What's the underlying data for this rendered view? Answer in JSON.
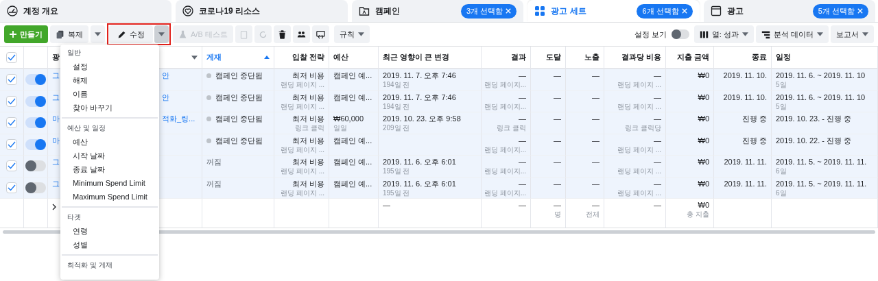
{
  "tabs": [
    {
      "label": "계정 개요",
      "kind": "gauge",
      "selected": false
    },
    {
      "label": "코로나19 리소스",
      "kind": "heart",
      "selected": false
    },
    {
      "label": "캠페인",
      "kind": "folder",
      "selected": false,
      "badge": "3개 선택함"
    },
    {
      "label": "광고 세트",
      "kind": "grid",
      "selected": true,
      "badge": "6개 선택함"
    },
    {
      "label": "광고",
      "kind": "window",
      "selected": false,
      "badge": "5개 선택함"
    }
  ],
  "toolbar": {
    "create": "만들기",
    "duplicate": "복제",
    "edit": "수정",
    "edit_highlighted": true,
    "ab_test": "A/B 테스트",
    "rules": "규칙",
    "view_setup": {
      "label": "설정 보기",
      "on": false
    },
    "columns": "열: 성과",
    "breakdown": "분석 데이터",
    "reports": "보고서"
  },
  "edit_menu": [
    {
      "title": "일반",
      "items": [
        "설정",
        "해제",
        "이름",
        "찾아 바꾸기"
      ]
    },
    {
      "title": "예산 및 일정",
      "items": [
        "예산",
        "시작 날짜",
        "종료 날짜",
        "Minimum Spend Limit",
        "Maximum Spend Limit"
      ]
    },
    {
      "title": "타겟",
      "items": [
        "연령",
        "성별"
      ]
    },
    {
      "title": "최적화 및 게재"
    }
  ],
  "table": {
    "all_checked": true,
    "columns": [
      {
        "label": "광",
        "sorted": false
      },
      {
        "label": "게재",
        "sorted": true
      },
      {
        "label": "입찰 전략",
        "sorted": false
      },
      {
        "label": "예산",
        "sorted": false
      },
      {
        "label": "최근 영향이 큰 변경",
        "sorted": false
      },
      {
        "label": "결과",
        "sorted": false
      },
      {
        "label": "도달",
        "sorted": false
      },
      {
        "label": "노출",
        "sorted": false
      },
      {
        "label": "결과당 비용",
        "sorted": false
      },
      {
        "label": "지출 금액",
        "sorted": false
      },
      {
        "label": "종료",
        "sorted": false
      },
      {
        "label": "일정",
        "sorted": false
      }
    ],
    "rows": [
      {
        "selected": true,
        "on": true,
        "cells": [
          {
            "text": "그",
            "text_end": "안"
          },
          {
            "kind": "paused",
            "text": "캠페인 중단됨"
          },
          {
            "text": "최저 비용",
            "sub": "랜딩 페이지 ..."
          },
          {
            "text": "캠페인 예..."
          },
          {
            "text": "2019. 11. 7. 오후 7:46",
            "sub": "194일 전"
          },
          {
            "text": "—",
            "sub": "랜딩 페이지..."
          },
          {
            "text": "—"
          },
          {
            "text": "—"
          },
          {
            "text": "—",
            "sub": "랜딩 페이지 ..."
          },
          {
            "text": "₩0"
          },
          {
            "text": "2019. 11. 10."
          },
          {
            "text": "2019. 11. 6. ~ 2019. 11. 10",
            "sub": "5일"
          }
        ]
      },
      {
        "selected": true,
        "on": true,
        "cells": [
          {
            "text": "그",
            "text_end": "안"
          },
          {
            "kind": "paused",
            "text": "캠페인 중단됨"
          },
          {
            "text": "최저 비용",
            "sub": "랜딩 페이지 ..."
          },
          {
            "text": "캠페인 예..."
          },
          {
            "text": "2019. 11. 7. 오후 7:46",
            "sub": "194일 전"
          },
          {
            "text": "—",
            "sub": "랜딩 페이지..."
          },
          {
            "text": "—"
          },
          {
            "text": "—"
          },
          {
            "text": "—",
            "sub": "랜딩 페이지 ..."
          },
          {
            "text": "₩0"
          },
          {
            "text": "2019. 11. 10."
          },
          {
            "text": "2019. 11. 6. ~ 2019. 11. 10",
            "sub": "5일"
          }
        ]
      },
      {
        "selected": true,
        "on": true,
        "cells": [
          {
            "text": "마",
            "text_end": "적화_링..."
          },
          {
            "kind": "paused",
            "text": "캠페인 중단됨"
          },
          {
            "text": "최저 비용",
            "sub": "링크 클릭"
          },
          {
            "text": "₩60,000",
            "sub": "일일"
          },
          {
            "text": "2019. 10. 23. 오후 9:58",
            "sub": "209일 전"
          },
          {
            "text": "—",
            "sub": "링크 클릭"
          },
          {
            "text": "—"
          },
          {
            "text": "—"
          },
          {
            "text": "—",
            "sub": "링크 클릭당"
          },
          {
            "text": "₩0"
          },
          {
            "text": "진행 중"
          },
          {
            "text": "2019. 10. 23. - 진행 중"
          }
        ]
      },
      {
        "selected": true,
        "on": true,
        "cells": [
          {
            "text": "마"
          },
          {
            "kind": "paused",
            "text": "캠페인 중단됨"
          },
          {
            "text": "최저 비용",
            "sub": "랜딩 페이지 ..."
          },
          {
            "text": "캠페인 예..."
          },
          null,
          {
            "text": "—",
            "sub": "랜딩 페이지..."
          },
          {
            "text": "—"
          },
          {
            "text": "—"
          },
          {
            "text": "—",
            "sub": "랜딩 페이지 ..."
          },
          {
            "text": "₩0"
          },
          {
            "text": "진행 중"
          },
          {
            "text": "2019. 10. 22. - 진행 중"
          }
        ]
      },
      {
        "selected": true,
        "on": false,
        "cells": [
          {
            "text": "그"
          },
          {
            "kind": "off",
            "text": "꺼짐"
          },
          {
            "text": "최저 비용",
            "sub": "랜딩 페이지 ..."
          },
          {
            "text": "캠페인 예..."
          },
          {
            "text": "2019. 11. 6. 오후 6:01",
            "sub": "195일 전"
          },
          {
            "text": "—",
            "sub": "랜딩 페이지..."
          },
          {
            "text": "—"
          },
          {
            "text": "—"
          },
          {
            "text": "—",
            "sub": "랜딩 페이지 ..."
          },
          {
            "text": "₩0"
          },
          {
            "text": "2019. 11. 11."
          },
          {
            "text": "2019. 11. 5. ~ 2019. 11. 11.",
            "sub": "6일"
          }
        ]
      },
      {
        "selected": true,
        "on": false,
        "cells": [
          {
            "text": "그"
          },
          {
            "kind": "off",
            "text": "꺼짐"
          },
          {
            "text": "최저 비용",
            "sub": "랜딩 페이지 ..."
          },
          {
            "text": "캠페인 예..."
          },
          {
            "text": "2019. 11. 6. 오후 6:01",
            "sub": "195일 전"
          },
          {
            "text": "—",
            "sub": "랜딩 페이지..."
          },
          {
            "text": "—"
          },
          {
            "text": "—"
          },
          {
            "text": "—",
            "sub": "랜딩 페이지 ..."
          },
          {
            "text": "₩0"
          },
          {
            "text": "2019. 11. 11."
          },
          {
            "text": "2019. 11. 5. ~ 2019. 11. 11.",
            "sub": "6일"
          }
        ]
      }
    ],
    "summary": {
      "recent_change": {
        "text": "—"
      },
      "results": {
        "text": "—"
      },
      "reach": {
        "text": "—",
        "sub": "명"
      },
      "impressions": {
        "text": "—",
        "sub": "전체"
      },
      "cost_per_result": {
        "text": "—"
      },
      "amount_spent": {
        "text": "₩0",
        "sub": "총 지출"
      }
    }
  }
}
